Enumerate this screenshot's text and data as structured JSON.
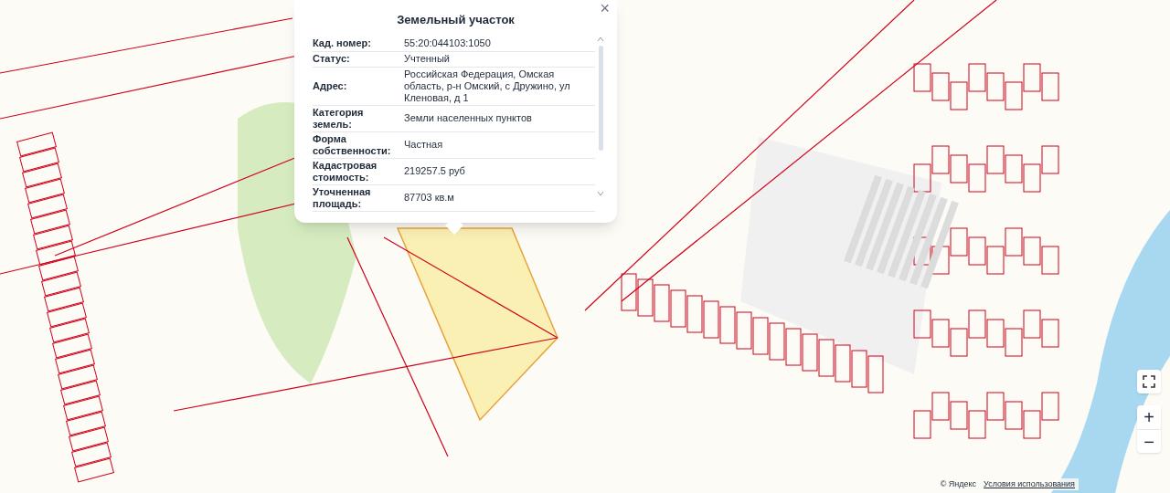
{
  "popup": {
    "title": "Земельный участок",
    "close": "×",
    "rows": [
      {
        "label": "Кад. номер:",
        "value": "55:20:044103:1050"
      },
      {
        "label": "Статус:",
        "value": "Учтенный"
      },
      {
        "label": "Адрес:",
        "value": "Российская Федерация, Омская область, р-н Омский, с Дружино, ул Кленовая, д 1"
      },
      {
        "label": "Категория земель:",
        "value": "Земли населенных пунктов"
      },
      {
        "label": "Форма собственности:",
        "value": "Частная"
      },
      {
        "label": "Кадастровая стоимость:",
        "value": "219257.5 руб"
      },
      {
        "label": "Уточненная площадь:",
        "value": "87703 кв.м"
      }
    ]
  },
  "map_controls": {
    "zoom_in": "+",
    "zoom_out": "−"
  },
  "copyright": {
    "owner": "© Яндекс",
    "terms": "Условия использования"
  }
}
